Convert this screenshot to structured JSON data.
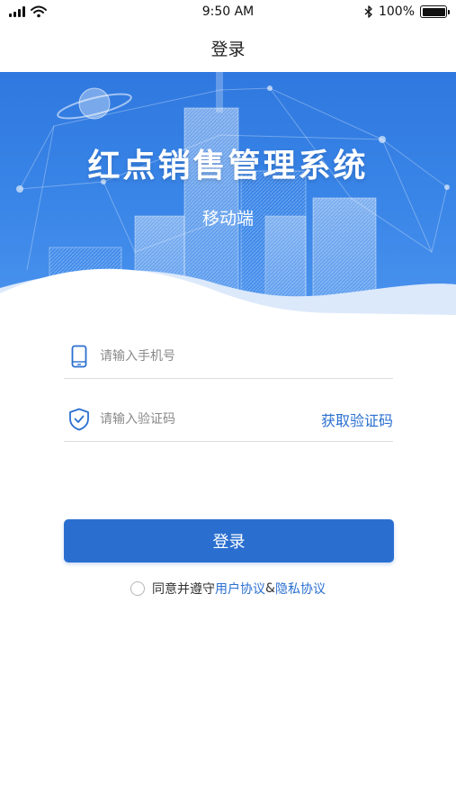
{
  "status_bar": {
    "time": "9:50 AM",
    "battery_text": "100%",
    "battery_level": 1.0,
    "icons": [
      "signal-icon",
      "wifi-icon",
      "bluetooth-icon",
      "battery-icon"
    ]
  },
  "nav": {
    "title": "登录"
  },
  "banner": {
    "title": "红点销售管理系统",
    "subtitle": "移动端"
  },
  "form": {
    "phone_placeholder": "请输入手机号",
    "code_placeholder": "请输入验证码",
    "get_code_label": "获取验证码",
    "phone_icon": "phone-icon",
    "code_icon": "shield-check-icon"
  },
  "login_button_label": "登录",
  "agreement": {
    "prefix": "同意并遵守",
    "user_agreement": "用户协议",
    "joiner": "&",
    "privacy_policy": "隐私协议"
  },
  "colors": {
    "accent": "#2a6fd0",
    "banner_top": "#2f78df",
    "banner_bottom": "#4b93ee"
  }
}
